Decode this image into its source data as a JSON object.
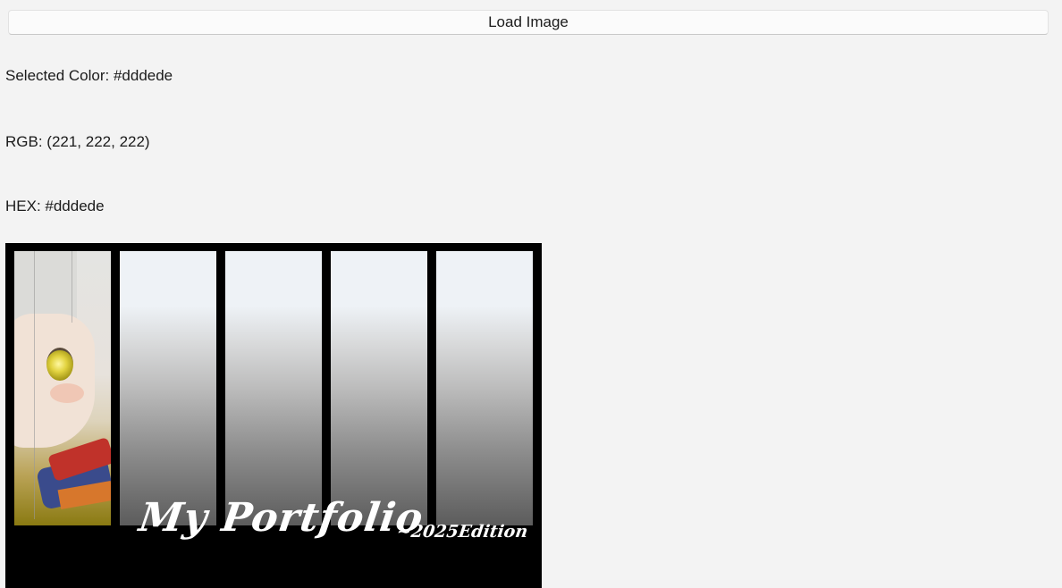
{
  "toolbar": {
    "load_label": "Load Image"
  },
  "info": {
    "selected_color": "Selected Color: #dddede",
    "rgb": "RGB: (221, 222, 222)",
    "hex": "HEX: #dddede"
  },
  "image": {
    "title_text": "My Portfolio",
    "edition_text": "~2025Edition"
  }
}
